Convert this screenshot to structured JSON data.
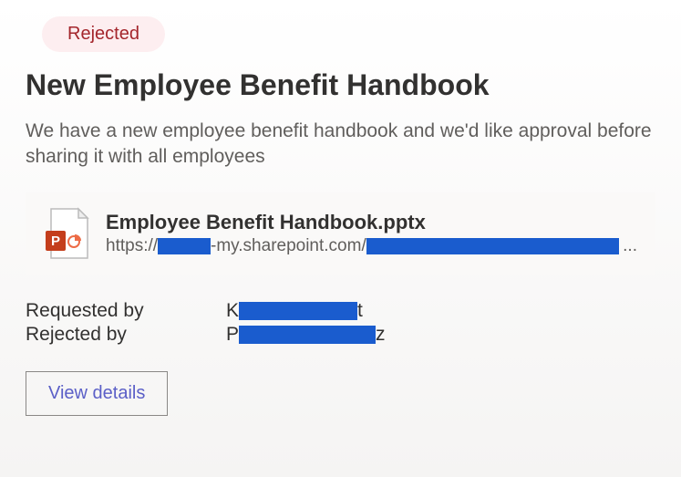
{
  "status": {
    "label": "Rejected"
  },
  "header": {
    "title": "New Employee Benefit Handbook",
    "description": "We have a new employee benefit handbook and we'd like approval before sharing it with all employees"
  },
  "attachment": {
    "filename": "Employee Benefit Handbook.pptx",
    "url_prefix": "https://",
    "url_mid": "-my.sharepoint.com/",
    "url_ellipsis": "..."
  },
  "meta": {
    "requested_by_label": "Requested by",
    "requested_by_initial": "K",
    "requested_by_suffix": "t",
    "rejected_by_label": "Rejected by",
    "rejected_by_initial": "P",
    "rejected_by_suffix": "z"
  },
  "actions": {
    "view_details": "View details"
  }
}
